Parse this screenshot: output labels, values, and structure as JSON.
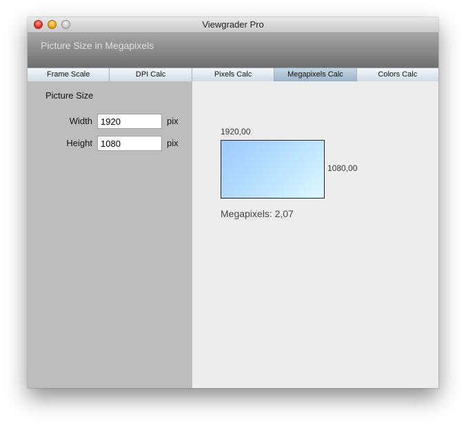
{
  "window": {
    "title": "Viewgrader Pro"
  },
  "header": {
    "title": "Picture Size in Megapixels"
  },
  "tabs": [
    {
      "label": "Frame Scale",
      "selected": false
    },
    {
      "label": "DPI Calc",
      "selected": false
    },
    {
      "label": "Pixels Calc",
      "selected": false
    },
    {
      "label": "Megapixels Calc",
      "selected": true
    },
    {
      "label": "Colors Calc",
      "selected": false
    }
  ],
  "form": {
    "section_title": "Picture Size",
    "width": {
      "label": "Width",
      "value": "1920",
      "unit": "pix"
    },
    "height": {
      "label": "Height",
      "value": "1080",
      "unit": "pix"
    }
  },
  "preview": {
    "width_label": "1920,00",
    "height_label": "1080,00",
    "result": "Megapixels: 2,07"
  },
  "colors": {
    "selected_tab": "#a9bdcd",
    "left_panel": "#bdbdbd",
    "right_panel": "#ededed"
  }
}
